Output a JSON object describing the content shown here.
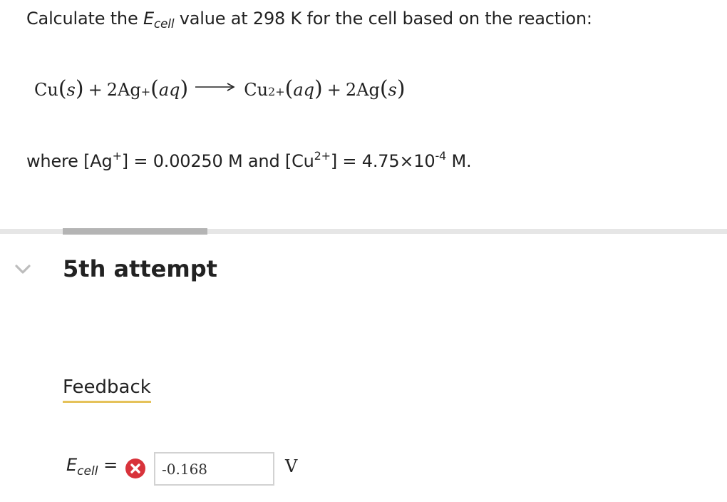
{
  "question": {
    "prefix": "Calculate the ",
    "e_symbol": "E",
    "e_subscript": "cell",
    "suffix": " value at 298 K for the cell based on the reaction:"
  },
  "equation": {
    "reactant1": "Cu",
    "state_s": "s",
    "plus": "+",
    "coef2": "2",
    "silver_ion": "Ag",
    "silver_charge": "+",
    "state_aq": "aq",
    "product1": "Cu",
    "copper_charge": "2+",
    "product2": "Ag"
  },
  "conditions": {
    "part1": "where [Ag",
    "ag_charge": "+",
    "part2": "] = 0.00250 M and [Cu",
    "cu_charge": "2+",
    "part3": "] = 4.75×10",
    "exponent": "-4",
    "part4": " M."
  },
  "progress": {
    "fraction": 0.199
  },
  "attempt": {
    "title": "5th attempt"
  },
  "feedback": {
    "label": "Feedback"
  },
  "answer": {
    "label_symbol": "E",
    "label_subscript": "cell",
    "equals": "=",
    "value": "-0.168",
    "unit": "V"
  },
  "colors": {
    "error_icon": "#d8333b",
    "feedback_underline": "#e5c25a",
    "progress_fill": "#b4b4b4",
    "progress_track": "#e6e6e6"
  }
}
